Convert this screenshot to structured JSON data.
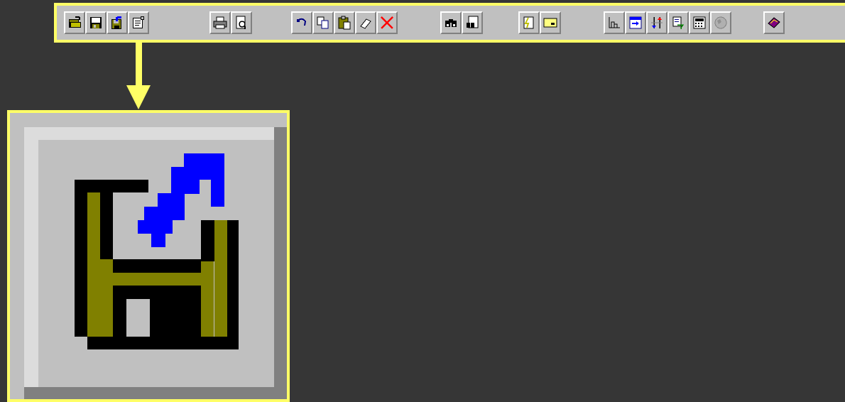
{
  "toolbar": {
    "buttons": [
      {
        "icon": "open-folder-icon"
      },
      {
        "icon": "save-icon"
      },
      {
        "icon": "save-export-icon"
      },
      {
        "icon": "properties-icon"
      },
      {
        "icon": "print-icon"
      },
      {
        "icon": "print-preview-icon"
      },
      {
        "icon": "undo-icon"
      },
      {
        "icon": "copy-icon"
      },
      {
        "icon": "paste-icon"
      },
      {
        "icon": "eraser-icon"
      },
      {
        "icon": "delete-icon"
      },
      {
        "icon": "find-icon"
      },
      {
        "icon": "find-in-page-icon"
      },
      {
        "icon": "report-icon"
      },
      {
        "icon": "form-icon"
      },
      {
        "icon": "chart-icon"
      },
      {
        "icon": "table-arrow-icon"
      },
      {
        "icon": "sort-icon"
      },
      {
        "icon": "filter-icon"
      },
      {
        "icon": "calculator-icon"
      },
      {
        "icon": "globe-disabled-icon"
      },
      {
        "icon": "help-book-icon"
      }
    ]
  },
  "zoom": {
    "icon": "save-export-icon"
  },
  "colors": {
    "highlight": "#ffff66",
    "background": "#363636",
    "button_face": "#c0c0c0"
  }
}
